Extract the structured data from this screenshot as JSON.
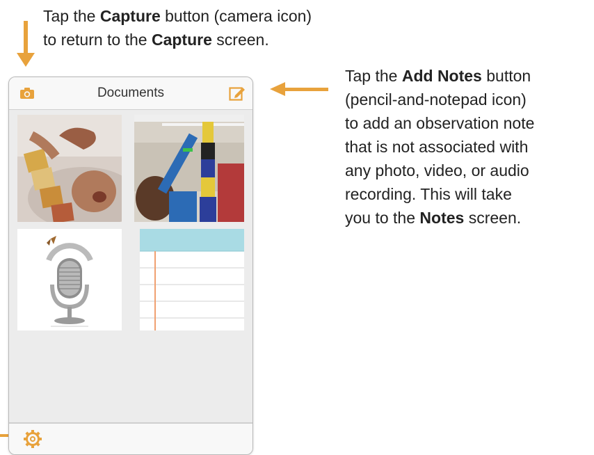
{
  "callouts": {
    "top": {
      "l1_pre": "Tap the ",
      "l1_bold": "Capture",
      "l1_post": " button (camera icon)",
      "l2_pre": "to return to the ",
      "l2_bold": "Capture",
      "l2_post": " screen."
    },
    "right": {
      "l1_pre": "Tap the ",
      "l1_bold": "Add Notes",
      "l1_post": " button",
      "l2": "(pencil-and-notepad icon)",
      "l3": "to add an observation note",
      "l4": "that is not associated with",
      "l5": "any photo, video, or audio",
      "l6": "recording. This will take",
      "l7_pre": "you to the ",
      "l7_bold": "Notes",
      "l7_post": " screen."
    }
  },
  "app": {
    "title": "Documents",
    "accent_color": "#e8a23c",
    "buttons": {
      "capture_icon": "camera-icon",
      "add_notes_icon": "pencil-notepad-icon",
      "settings_icon": "gear-icon"
    },
    "documents": [
      {
        "type": "photo",
        "subject": "child with alphabet blocks"
      },
      {
        "type": "photo",
        "subject": "child stacking tall block tower"
      },
      {
        "type": "audio",
        "icon": "microphone-icon"
      },
      {
        "type": "note",
        "icon": "notepad-icon"
      }
    ]
  }
}
